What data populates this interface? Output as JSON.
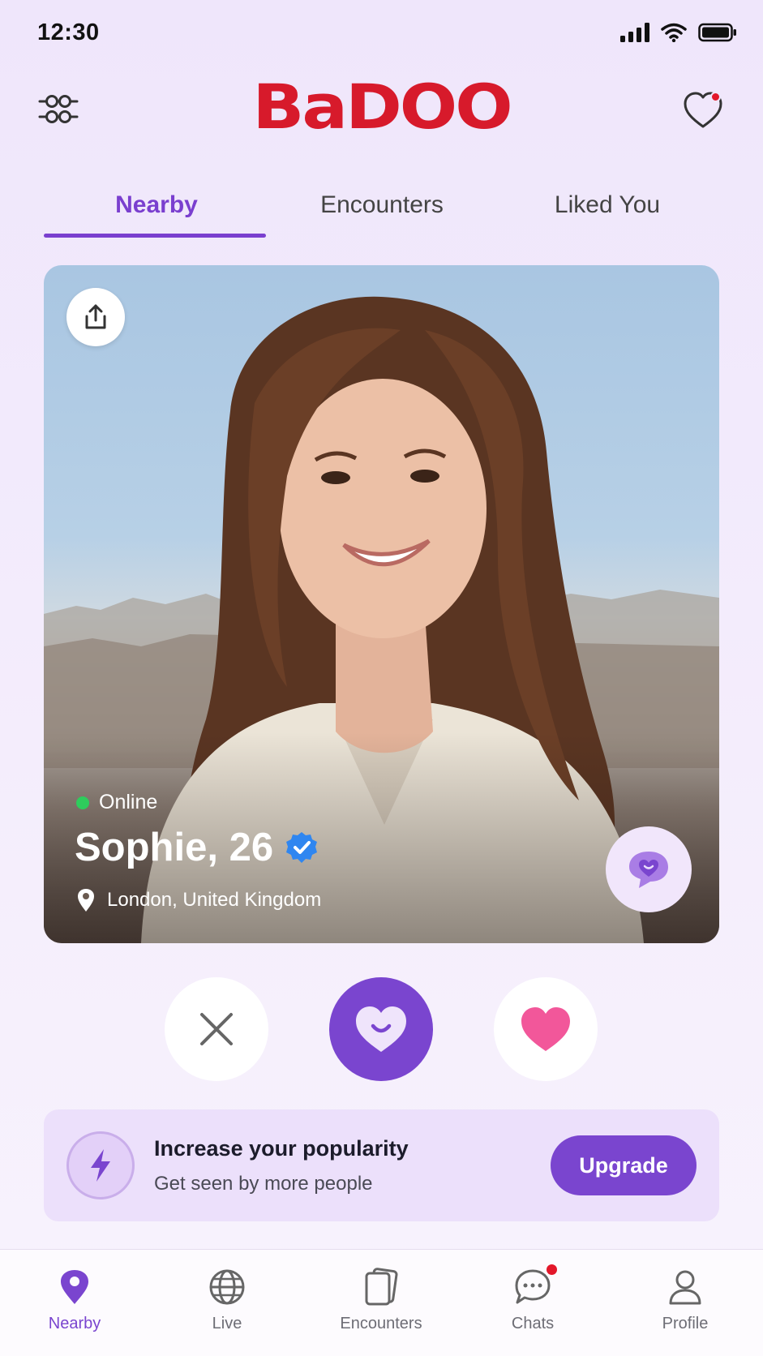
{
  "status_bar": {
    "time": "12:30"
  },
  "header": {
    "brand": "BaDOO"
  },
  "tabs": [
    {
      "label": "Nearby",
      "active": true
    },
    {
      "label": "Encounters",
      "active": false
    },
    {
      "label": "Liked You",
      "active": false
    }
  ],
  "profile": {
    "status": "Online",
    "name_age": "Sophie, 26",
    "verified": true,
    "location": "London, United Kingdom"
  },
  "actions": [
    "close-icon",
    "smile-heart-icon",
    "heart-icon"
  ],
  "promo": {
    "title": "Increase your popularity",
    "subtitle": "Get seen by more people",
    "button": "Upgrade"
  },
  "bottom_nav": [
    {
      "label": "Nearby",
      "icon": "location-pin-icon",
      "active": true
    },
    {
      "label": "Live",
      "icon": "globe-icon",
      "active": false
    },
    {
      "label": "Encounters",
      "icon": "cards-icon",
      "active": false
    },
    {
      "label": "Chats",
      "icon": "chat-bubble-icon",
      "active": false,
      "badge": true
    },
    {
      "label": "Profile",
      "icon": "person-icon",
      "active": false
    }
  ],
  "colors": {
    "accent": "#7a45cf",
    "brand": "#d71a2b",
    "like": "#f2579a",
    "online": "#2ecc5c"
  }
}
